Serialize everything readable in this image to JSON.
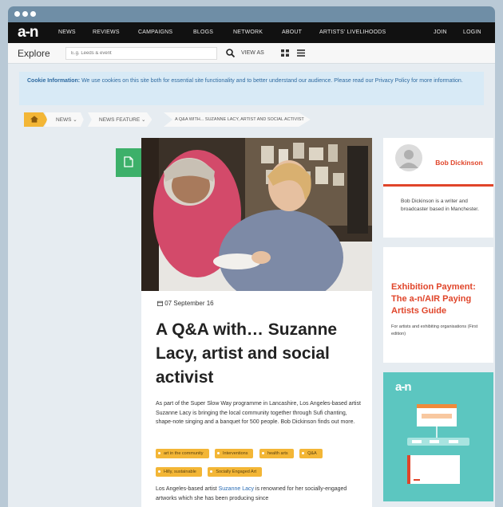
{
  "nav": {
    "logo": "a-n",
    "items": [
      "NEWS",
      "REVIEWS",
      "CAMPAIGNS",
      "BLOGS",
      "NETWORK",
      "ABOUT",
      "ARTISTS' LIVELIHOODS"
    ],
    "join": "JOIN",
    "login": "LOGIN"
  },
  "explore": {
    "label": "Explore",
    "placeholder": "E.g. Leeds & event",
    "view_as": "VIEW AS"
  },
  "cookie": {
    "heading": "Cookie Information:",
    "text": "We use cookies on this site both for essential site functionality and to better understand our audience. Please read our Privacy Policy for more information."
  },
  "breadcrumb": {
    "items": [
      "NEWS",
      "NEWS FEATURE",
      "A Q&A WITH... SUZANNE LACY, ARTIST AND SOCIAL ACTIVIST"
    ]
  },
  "article": {
    "date": "07 September 16",
    "title": "A Q&A with… Suzanne Lacy, artist and social activist",
    "lede": "As part of the Super Slow Way programme in Lancashire, Los Angeles-based artist Suzanne Lacy is bringing the local community together through Sufi chanting, shape-note singing and a banquet for 500 people. Bob Dickinson finds out more.",
    "tags": [
      "art in the community",
      "Interventions",
      "health arts",
      "Q&A",
      "Hilly, sustainable",
      "Socially Engaged Art"
    ],
    "body_start": "Los Angeles-based artist ",
    "body_link": "Suzanne Lacy",
    "body_rest": " is renowned for her socially-engaged artworks which she has been producing since"
  },
  "author": {
    "name": "Bob Dickinson",
    "bio": "Bob Dickinson is a writer and broadcaster based in Manchester."
  },
  "ad": {
    "title": "Exhibition Payment: The a-n/AIR Paying Artists Guide",
    "subtitle": "For artists and exhibiting organisations (First edition)"
  },
  "promo": {
    "logo": "a-n"
  },
  "colors": {
    "accent_orange": "#f3b636",
    "accent_red": "#e0452a",
    "doc_green": "#3db06a",
    "promo_teal": "#5cc6c0"
  }
}
